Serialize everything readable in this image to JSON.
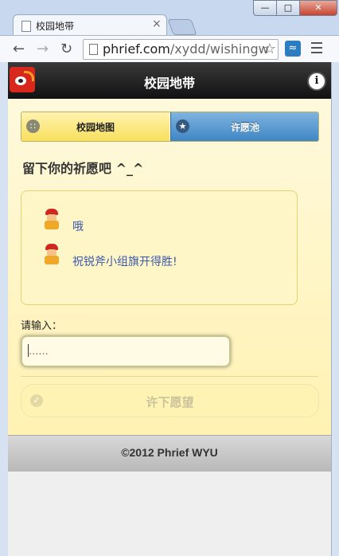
{
  "browser": {
    "tab_title": "校园地带",
    "tab_close": "×",
    "url_host": "phrief.com",
    "url_path": "/xydd/wishingw",
    "window_buttons": {
      "min": "—",
      "max": "□",
      "close": "✕"
    }
  },
  "header": {
    "title": "校园地带",
    "info_label": "i"
  },
  "nav": {
    "items": [
      {
        "label": "校园地图",
        "icon": "grid-icon",
        "active": false
      },
      {
        "label": "许愿池",
        "icon": "star-icon",
        "active": true
      }
    ]
  },
  "main": {
    "heading": "留下你的祈愿吧 ^_^",
    "wishes": [
      {
        "text": "哦"
      },
      {
        "text": "祝锐斧小组旗开得胜!"
      }
    ],
    "input_label": "请输入：",
    "input_placeholder": "......",
    "submit_label": "许下愿望"
  },
  "footer": {
    "text": "©2012 Phrief WYU"
  },
  "colors": {
    "accent_blue": "#3f86c4",
    "content_yellow": "#fff2b2",
    "header_dark": "#111111",
    "link_blue": "#3d5aa8"
  }
}
